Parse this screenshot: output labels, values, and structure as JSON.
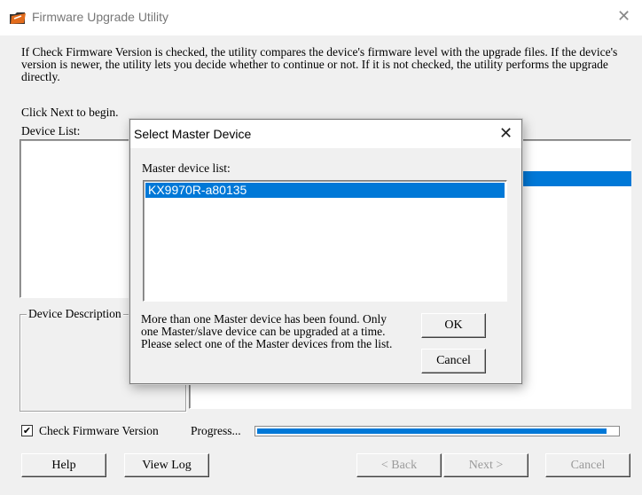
{
  "window": {
    "title": "Firmware Upgrade Utility",
    "close_glyph": "✕",
    "icon": "firmware-folder-icon"
  },
  "main": {
    "info_text": "If Check Firmware Version is checked, the utility compares the device's firmware level with the upgrade files. If the device's version is newer, the utility lets you decide whether to continue or not. If it is not checked, the utility performs the upgrade directly.",
    "begin_text": "Click Next to begin.",
    "device_list_label": "Device List:",
    "device_description_label": "Device Description",
    "check_firmware_label": "Check Firmware Version",
    "check_firmware_checked": true,
    "check_glyph": "✔",
    "progress_label": "Progress...",
    "progress_fraction": 0.97,
    "buttons": {
      "help": "Help",
      "view_log": "View Log",
      "back": "< Back",
      "next": "Next >",
      "cancel": "Cancel"
    }
  },
  "dialog": {
    "title": "Select Master Device",
    "close_glyph": "✕",
    "list_label": "Master device list:",
    "items": [
      "KX9970R-a80135"
    ],
    "selected_index": 0,
    "message": "More than one Master device has been found. Only one Master/slave device can be upgraded at a time. Please select one of the Master devices from the list.",
    "ok_label": "OK",
    "cancel_label": "Cancel"
  },
  "colors": {
    "selection": "#0078d7",
    "progress": "#0078d7"
  }
}
